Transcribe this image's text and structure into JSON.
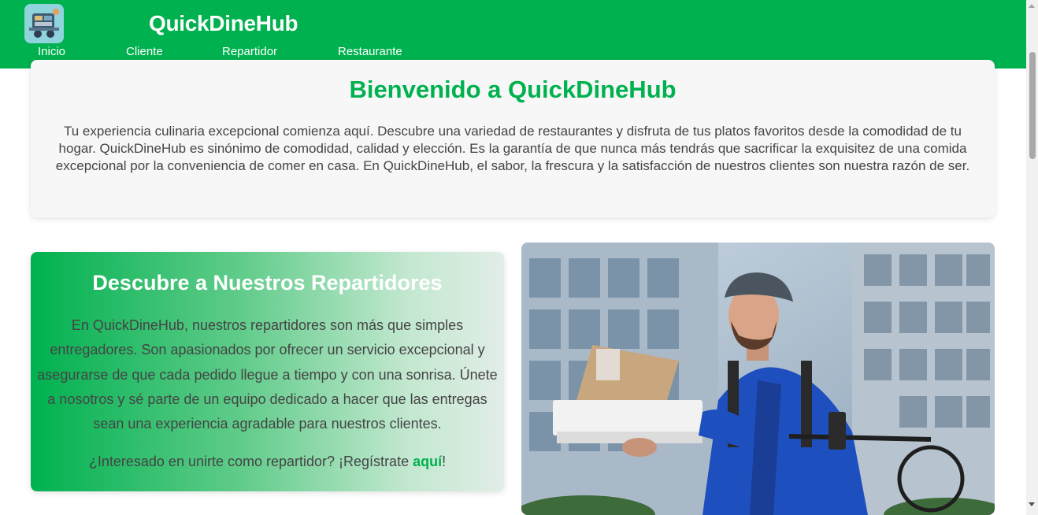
{
  "header": {
    "brand": "QuickDineHub",
    "logo_icon": "restaurant-app-icon",
    "nav": [
      {
        "label": "Inicio"
      },
      {
        "label": "Cliente"
      },
      {
        "label": "Repartidor"
      },
      {
        "label": "Restaurante"
      }
    ]
  },
  "welcome": {
    "title": "Bienvenido a QuickDineHub",
    "text": "Tu experiencia culinaria excepcional comienza aquí. Descubre una variedad de restaurantes y disfruta de tus platos favoritos desde la comodidad de tu hogar. QuickDineHub es sinónimo de comodidad, calidad y elección. Es la garantía de que nunca más tendrás que sacrificar la exquisitez de una comida excepcional por la conveniencia de comer en casa. En QuickDineHub, el sabor, la frescura y la satisfacción de nuestros clientes son nuestra razón de ser."
  },
  "riders": {
    "title": "Descubre a Nuestros Repartidores",
    "description": "En QuickDineHub, nuestros repartidores son más que simples entregadores. Son apasionados por ofrecer un servicio excepcional y asegurarse de que cada pedido llegue a tiempo y con una sonrisa. Únete a nosotros y sé parte de un equipo dedicado a hacer que las entregas sean una experiencia agradable para nuestros clientes.",
    "cta_prefix": "¿Interesado en unirte como repartidor? ¡Regístrate ",
    "cta_link": "aquí",
    "cta_suffix": "!"
  },
  "photo": {
    "subject": "delivery-rider-photo"
  },
  "colors": {
    "brand_green": "#00b14f",
    "text_gray": "#444444",
    "card_bg": "#f7f7f7"
  }
}
